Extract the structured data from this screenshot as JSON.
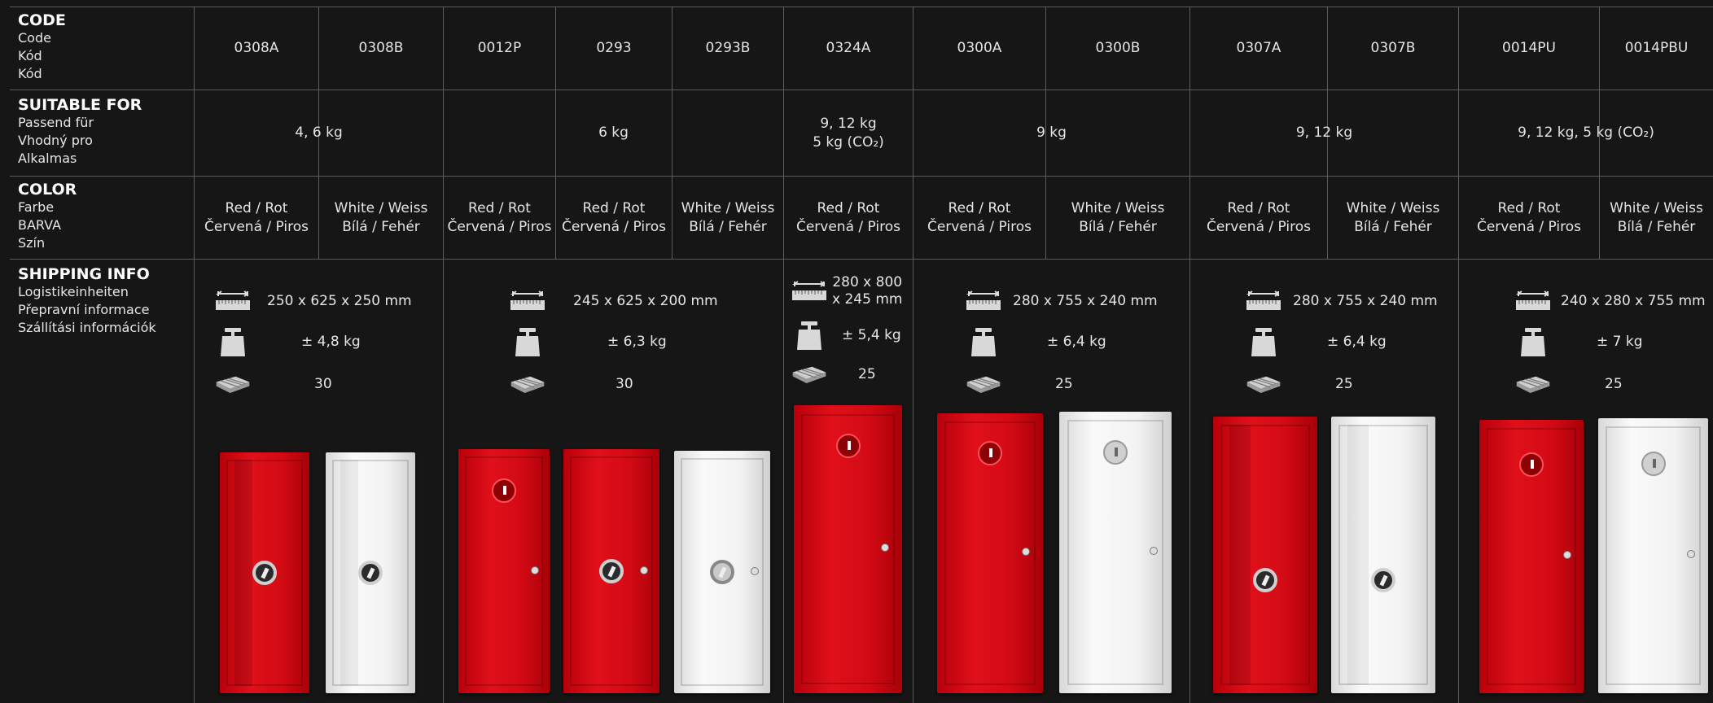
{
  "headers": {
    "code": {
      "title": "CODE",
      "lines": [
        "Code",
        "Kód",
        "Kód"
      ]
    },
    "suitable": {
      "title": "SUITABLE FOR",
      "lines": [
        "Passend für",
        "Vhodný pro",
        "Alkalmas"
      ]
    },
    "color": {
      "title": "COLOR",
      "lines": [
        "Farbe",
        "BARVA",
        "Szín"
      ]
    },
    "shipping": {
      "title": "SHIPPING INFO",
      "lines": [
        "Logistikeinheiten",
        "Přepravní informace",
        "Szállítási információk"
      ]
    }
  },
  "codes": [
    "0308A",
    "0308B",
    "0012P",
    "0293",
    "0293B",
    "0324A",
    "0300A",
    "0300B",
    "0307A",
    "0307B",
    "0014PU",
    "0014PBU"
  ],
  "suitable": [
    {
      "lines": [
        "4, 6 kg"
      ]
    },
    {
      "lines": [
        "6 kg"
      ]
    },
    {
      "lines": [
        "9, 12 kg",
        "5 kg (CO₂)"
      ]
    },
    {
      "lines": [
        "9 kg"
      ]
    },
    {
      "lines": [
        "9, 12 kg"
      ]
    },
    {
      "lines": [
        "9, 12 kg, 5 kg (CO₂)"
      ]
    }
  ],
  "colors": {
    "red": [
      "Red / Rot",
      "Červená / Piros"
    ],
    "white": [
      "White / Weiss",
      "Bílá / Fehér"
    ]
  },
  "shipping": [
    {
      "dims": "250 x 625 x 250 mm",
      "weight": "± 4,8 kg",
      "pallet": "30"
    },
    {
      "dims": "245 x 625 x 200 mm",
      "weight": "± 6,3 kg",
      "pallet": "30"
    },
    {
      "dims_lines": [
        "280 x 800",
        "x 245 mm"
      ],
      "weight": "± 5,4 kg",
      "pallet": "25"
    },
    {
      "dims": "280 x 755 x 240 mm",
      "weight": "± 6,4 kg",
      "pallet": "25"
    },
    {
      "dims": "280 x 755 x 240 mm",
      "weight": "± 6,4 kg",
      "pallet": "25"
    },
    {
      "dims": "240 x 280 x 755 mm",
      "weight": "± 7 kg",
      "pallet": "25"
    }
  ],
  "icons": [
    "ruler-icon",
    "scale-icon",
    "pallet-icon"
  ],
  "palette": {
    "background": "#161616",
    "grid": "#5c5c5c",
    "red": "#d20a14",
    "white": "#f2f2f2"
  }
}
